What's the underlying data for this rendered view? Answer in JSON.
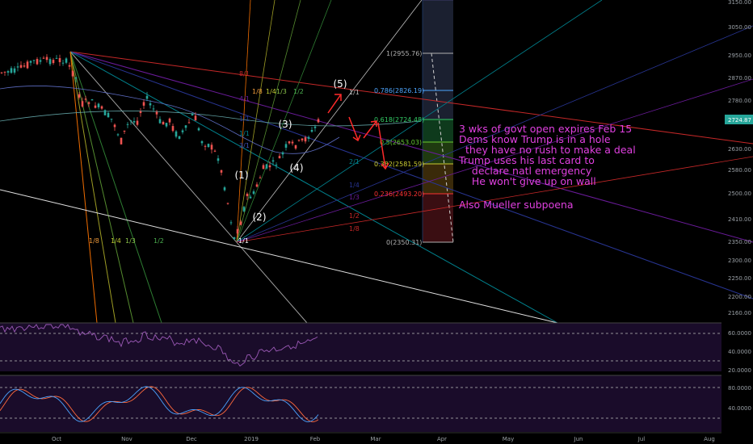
{
  "chart_data": {
    "type": "candlestick",
    "price_axis": {
      "ticks": [
        3150,
        3050,
        2950,
        2870,
        2780,
        2724.87,
        2630,
        2580,
        2500,
        2410,
        2350,
        2300,
        2250,
        2200,
        2160
      ],
      "labels": [
        "3150.00",
        "3050.00",
        "2950.00",
        "2870.00",
        "2780.00",
        "2724.87",
        "2630.00",
        "2580.00",
        "2500.00",
        "2410.00",
        "2350.00",
        "2300.00",
        "2250.00",
        "2200.00",
        "2160.00"
      ],
      "current_price": 2724.87,
      "current_price_label": "2724.87"
    },
    "time_axis": {
      "labels": [
        "Oct",
        "Nov",
        "Dec",
        "2019",
        "Feb",
        "Mar",
        "Apr",
        "May",
        "Jun",
        "Jul",
        "Aug"
      ]
    },
    "fibonacci": {
      "levels": [
        {
          "ratio": "1",
          "label": "1(2955.76)",
          "price": 2955.76,
          "color": "#b0b0b0"
        },
        {
          "ratio": "0.786",
          "label": "0.786(2826.19)",
          "price": 2826.19,
          "color": "#4da6ff"
        },
        {
          "ratio": "0.618",
          "label": "0.618(2724.48)",
          "price": 2724.48,
          "color": "#33cc66"
        },
        {
          "ratio": "0.5",
          "label": "0.5(2653.03)",
          "price": 2653.03,
          "color": "#66cc33"
        },
        {
          "ratio": "0.382",
          "label": "0.382(2581.59)",
          "price": 2581.59,
          "color": "#cccc33"
        },
        {
          "ratio": "0.236",
          "label": "0.236(2493.20)",
          "price": 2493.2,
          "color": "#ff3333"
        },
        {
          "ratio": "0",
          "label": "0(2350.31)",
          "price": 2350.31,
          "color": "#b0b0b0"
        }
      ]
    },
    "gann_fan_labels": {
      "top": [
        "1/8",
        "1/4",
        "1/3",
        "1/2"
      ],
      "bottom": [
        "1/8",
        "1/4",
        "1/3",
        "1/2"
      ],
      "angles": [
        "8/1",
        "4/1",
        "3/1",
        "2/1",
        "1/1",
        "1/1",
        "1/2",
        "1/3",
        "1/4",
        "1/8",
        "1/1",
        "1/1"
      ]
    },
    "elliott_waves": [
      "(1)",
      "(2)",
      "(3)",
      "(4)",
      "(5)"
    ],
    "annotation": {
      "lines": [
        "3 wks of govt open expires Feb 15",
        "Dems know Trump is in a hole",
        "  they have no rush to make a deal",
        "Trump uses his last card to",
        "    declare natl emergency",
        "    He won't give up on wall",
        "",
        "Also Mueller subpoena"
      ]
    },
    "rsi_panel": {
      "ticks": [
        60,
        40,
        20
      ],
      "labels": [
        "60.0000",
        "40.0000",
        "20.0000"
      ]
    },
    "stoch_panel": {
      "ticks": [
        80,
        40
      ],
      "labels": [
        "80.0000",
        "40.0000"
      ]
    },
    "colors": {
      "up": "#26a69a",
      "down": "#ef5350",
      "note": "#e040e0",
      "rsi": "#9b59b6",
      "stoch_k": "#4aa3ff",
      "stoch_d": "#ff6a3d",
      "price_tag": "#26a69a"
    }
  }
}
